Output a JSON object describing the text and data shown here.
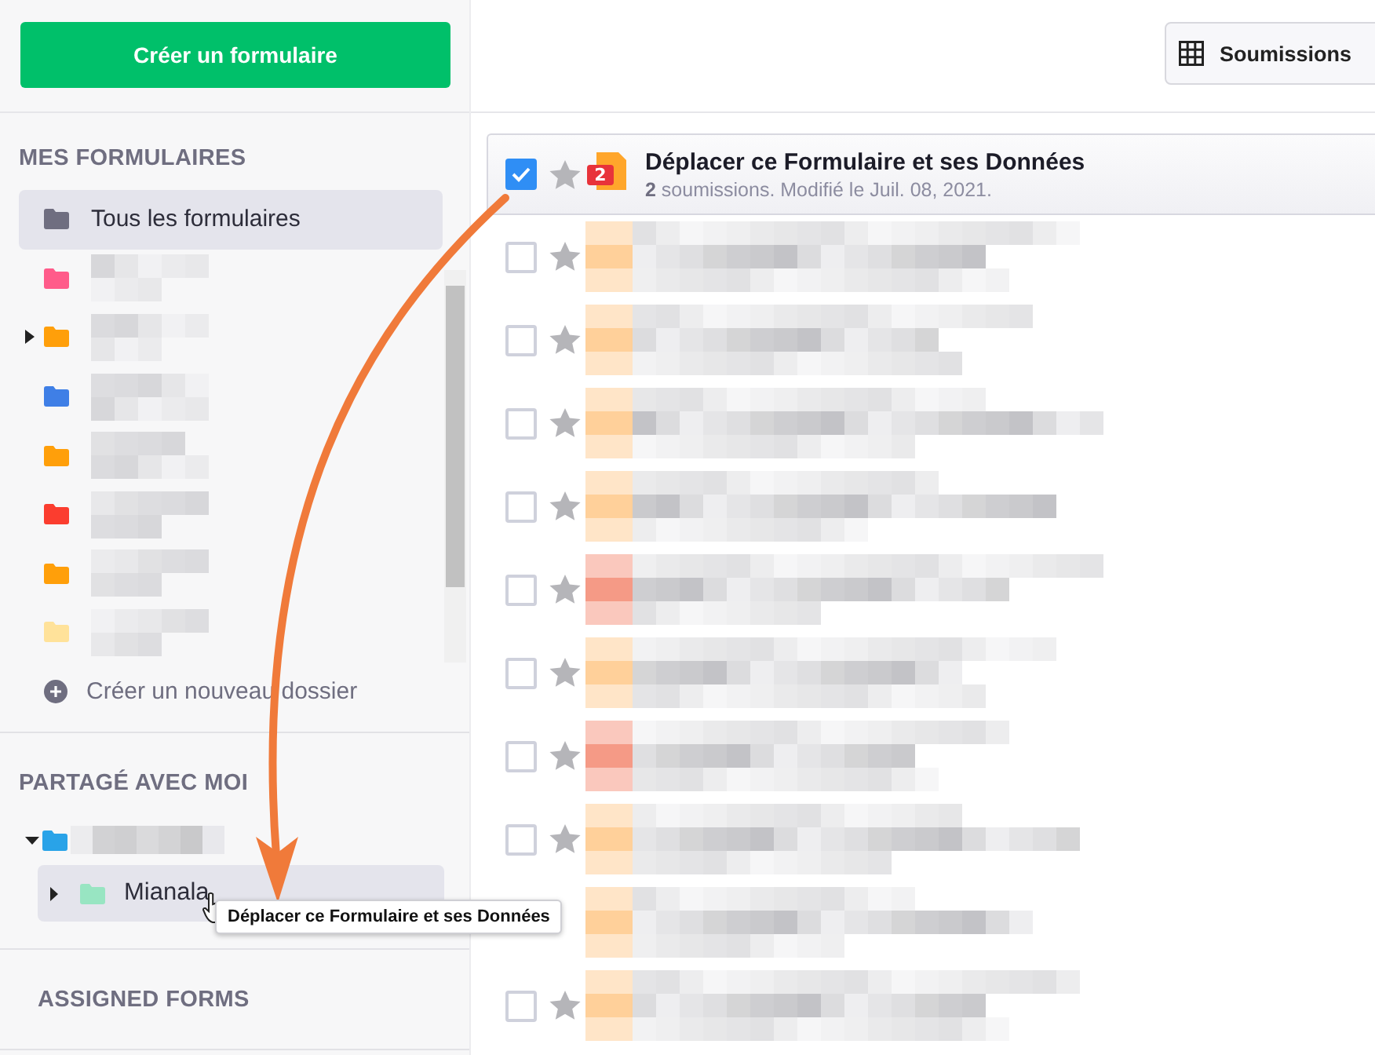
{
  "sidebar": {
    "create_button": "Créer un formulaire",
    "my_forms": {
      "heading": "MES FORMULAIRES",
      "items": [
        {
          "label": "Tous les formulaires",
          "color": "#6f6e80",
          "selected": true,
          "caret": false
        },
        {
          "color": "#ff5b8a",
          "selected": false,
          "caret": false
        },
        {
          "color": "#ff9f0a",
          "selected": false,
          "caret": true
        },
        {
          "color": "#3f7fe6",
          "selected": false,
          "caret": false
        },
        {
          "color": "#ff9f0a",
          "selected": false,
          "caret": false
        },
        {
          "color": "#fb3d2f",
          "selected": false,
          "caret": false
        },
        {
          "color": "#ff9f0a",
          "selected": false,
          "caret": false
        },
        {
          "color": "#ffe29a",
          "selected": false,
          "caret": false
        }
      ],
      "new_folder": "Créer un nouveau dossier"
    },
    "shared": {
      "heading": "PARTAGÉ AVEC MOI",
      "items": [
        {
          "color": "#29a3e8",
          "expanded": true,
          "selected": false,
          "children": [
            {
              "label": "Mianala",
              "color": "#98e5c2",
              "expanded": false,
              "selected": true
            }
          ]
        }
      ]
    },
    "assigned": {
      "heading": "ASSIGNED FORMS"
    }
  },
  "toolbar": {
    "view_button": "Soumissions"
  },
  "forms": [
    {
      "kind": "form",
      "selected": true,
      "checked": true,
      "starred": false,
      "color": "#ffa62b",
      "badge": "2",
      "title": "Déplacer ce Formulaire et ses Données",
      "meta": "**2** soumissions. Modifié le Juil. 08, 2021."
    },
    {
      "kind": "obscured",
      "checked": false,
      "starred": false,
      "color": "#ffd09a"
    },
    {
      "kind": "obscured",
      "checked": false,
      "starred": false,
      "color": "#ffd09a"
    },
    {
      "kind": "obscured",
      "checked": false,
      "starred": false,
      "color": "#ffd09a"
    },
    {
      "kind": "obscured",
      "checked": false,
      "starred": false,
      "color": "#ffd09a"
    },
    {
      "kind": "obscured",
      "checked": false,
      "starred": false,
      "color": "#f59a86"
    },
    {
      "kind": "obscured",
      "checked": false,
      "starred": false,
      "color": "#ffd09a"
    },
    {
      "kind": "obscured",
      "checked": false,
      "starred": false,
      "color": "#f59a86"
    },
    {
      "kind": "obscured",
      "checked": false,
      "starred": false,
      "color": "#ffd09a"
    },
    {
      "kind": "obscured",
      "color": "#ffd09a"
    },
    {
      "kind": "obscured",
      "checked": false,
      "starred": false,
      "color": "#ffd09a"
    }
  ],
  "drag": {
    "tooltip": "Déplacer ce Formulaire et ses Données"
  }
}
